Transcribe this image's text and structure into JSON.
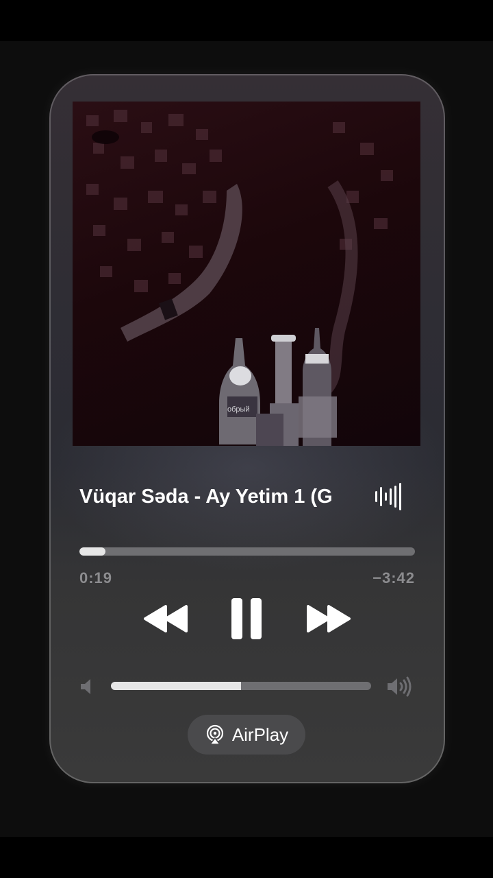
{
  "player": {
    "track_title": "Vüqar Səda - Ay Yetim 1 (G",
    "elapsed": "0:19",
    "remaining": "−3:42",
    "progress_fraction": 0.078,
    "volume_fraction": 0.5,
    "airplay_label": "AirPlay"
  },
  "artwork": {
    "bottle_label": "обрый"
  },
  "icons": {
    "waveform": "waveform-icon",
    "rewind": "rewind-icon",
    "pause": "pause-icon",
    "fast_forward": "fast-forward-icon",
    "volume_low": "speaker-low-icon",
    "volume_high": "speaker-high-icon",
    "airplay": "airplay-icon"
  },
  "colors": {
    "accent": "#ffffff",
    "track_bg": "#6f6f72",
    "muted_text": "#8c8c8f"
  }
}
